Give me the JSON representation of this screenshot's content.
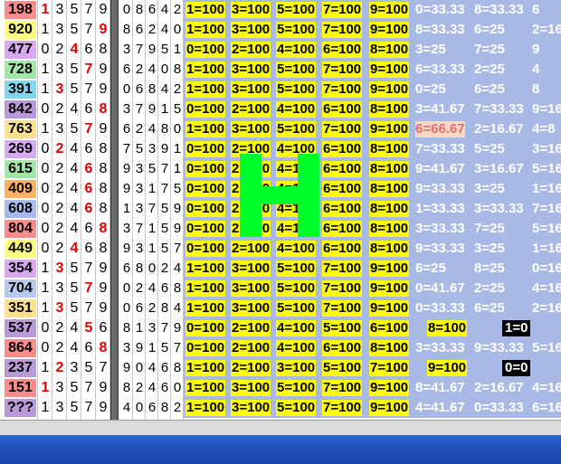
{
  "rows": [
    {
      "code": "198",
      "code_bg": "#ff8c8c",
      "digits": [
        "1",
        "3",
        "5",
        "7",
        "9"
      ],
      "hot": [
        0
      ],
      "perm": [
        "0",
        "8",
        "6",
        "4",
        "2"
      ],
      "cells": [
        [
          "1=100",
          "y"
        ],
        [
          "3=100",
          "y"
        ],
        [
          "5=100",
          "y"
        ],
        [
          "7=100",
          "y"
        ],
        [
          "9=100",
          "y"
        ],
        [
          "0=33.33",
          "w"
        ],
        [
          "8=33.33",
          "w"
        ],
        [
          "6",
          "w"
        ]
      ]
    },
    {
      "code": "920",
      "code_bg": "#ffff7f",
      "digits": [
        "1",
        "3",
        "5",
        "7",
        "9"
      ],
      "hot": [
        4
      ],
      "perm": [
        "8",
        "6",
        "2",
        "4",
        "0"
      ],
      "cells": [
        [
          "1=100",
          "y"
        ],
        [
          "3=100",
          "y"
        ],
        [
          "5=100",
          "y"
        ],
        [
          "7=100",
          "y"
        ],
        [
          "9=100",
          "y"
        ],
        [
          "8=33.33",
          "w"
        ],
        [
          "6=25",
          "w"
        ],
        [
          "2=16",
          "w"
        ]
      ]
    },
    {
      "code": "477",
      "code_bg": "#d8a8f0",
      "digits": [
        "0",
        "2",
        "4",
        "6",
        "8"
      ],
      "hot": [
        2
      ],
      "perm": [
        "3",
        "7",
        "9",
        "5",
        "1"
      ],
      "cells": [
        [
          "0=100",
          "y"
        ],
        [
          "2=100",
          "y"
        ],
        [
          "4=100",
          "y"
        ],
        [
          "6=100",
          "y"
        ],
        [
          "8=100",
          "y"
        ],
        [
          "3=25",
          "w"
        ],
        [
          "7=25",
          "w"
        ],
        [
          "9",
          "w"
        ]
      ]
    },
    {
      "code": "728",
      "code_bg": "#9fe8a8",
      "digits": [
        "1",
        "3",
        "5",
        "7",
        "9"
      ],
      "hot": [
        3
      ],
      "perm": [
        "6",
        "2",
        "4",
        "0",
        "8"
      ],
      "cells": [
        [
          "1=100",
          "y"
        ],
        [
          "3=100",
          "y"
        ],
        [
          "5=100",
          "y"
        ],
        [
          "7=100",
          "y"
        ],
        [
          "9=100",
          "y"
        ],
        [
          "6=33.33",
          "w"
        ],
        [
          "2=25",
          "w"
        ],
        [
          "4",
          "w"
        ]
      ]
    },
    {
      "code": "391",
      "code_bg": "#7fd8f0",
      "digits": [
        "1",
        "3",
        "5",
        "7",
        "9"
      ],
      "hot": [
        1
      ],
      "perm": [
        "0",
        "6",
        "8",
        "4",
        "2"
      ],
      "cells": [
        [
          "1=100",
          "y"
        ],
        [
          "3=100",
          "y"
        ],
        [
          "5=100",
          "y"
        ],
        [
          "7=100",
          "y"
        ],
        [
          "9=100",
          "y"
        ],
        [
          "0=25",
          "w"
        ],
        [
          "6=25",
          "w"
        ],
        [
          "8",
          "w"
        ]
      ]
    },
    {
      "code": "842",
      "code_bg": "#b89ad8",
      "digits": [
        "0",
        "2",
        "4",
        "6",
        "8"
      ],
      "hot": [
        4
      ],
      "perm": [
        "3",
        "7",
        "9",
        "1",
        "5"
      ],
      "cells": [
        [
          "0=100",
          "y"
        ],
        [
          "2=100",
          "y"
        ],
        [
          "4=100",
          "y"
        ],
        [
          "6=100",
          "y"
        ],
        [
          "8=100",
          "y"
        ],
        [
          "3=41.67",
          "w"
        ],
        [
          "7=33.33",
          "w"
        ],
        [
          "9=16",
          "w"
        ]
      ]
    },
    {
      "code": "763",
      "code_bg": "#ffe08a",
      "digits": [
        "1",
        "3",
        "5",
        "7",
        "9"
      ],
      "hot": [
        3
      ],
      "perm": [
        "6",
        "2",
        "4",
        "8",
        "0"
      ],
      "cells": [
        [
          "1=100",
          "y"
        ],
        [
          "3=100",
          "y"
        ],
        [
          "5=100",
          "y"
        ],
        [
          "7=100",
          "y"
        ],
        [
          "9=100",
          "y"
        ],
        [
          "6=66.67",
          "pk"
        ],
        [
          "2=16.67",
          "w"
        ],
        [
          "4=8",
          "w"
        ]
      ]
    },
    {
      "code": "269",
      "code_bg": "#d8a8f0",
      "digits": [
        "0",
        "2",
        "4",
        "6",
        "8"
      ],
      "hot": [
        1
      ],
      "perm": [
        "7",
        "5",
        "3",
        "9",
        "1"
      ],
      "cells": [
        [
          "0=100",
          "y"
        ],
        [
          "2=100",
          "y"
        ],
        [
          "4=100",
          "y"
        ],
        [
          "6=100",
          "y"
        ],
        [
          "8=100",
          "y"
        ],
        [
          "7=33.33",
          "w"
        ],
        [
          "5=25",
          "w"
        ],
        [
          "3=16",
          "w"
        ]
      ]
    },
    {
      "code": "615",
      "code_bg": "#9fe8a8",
      "digits": [
        "0",
        "2",
        "4",
        "6",
        "8"
      ],
      "hot": [
        3
      ],
      "perm": [
        "9",
        "3",
        "5",
        "7",
        "1"
      ],
      "cells": [
        [
          "0=100",
          "y"
        ],
        [
          "2=100",
          "y"
        ],
        [
          "4=100",
          "y"
        ],
        [
          "6=100",
          "y"
        ],
        [
          "8=100",
          "y"
        ],
        [
          "9=41.67",
          "w"
        ],
        [
          "3=16.67",
          "w"
        ],
        [
          "5=16",
          "w"
        ]
      ]
    },
    {
      "code": "409",
      "code_bg": "#ffb060",
      "digits": [
        "0",
        "2",
        "4",
        "6",
        "8"
      ],
      "hot": [
        3
      ],
      "perm": [
        "9",
        "3",
        "1",
        "7",
        "5"
      ],
      "cells": [
        [
          "0=100",
          "y"
        ],
        [
          "2=100",
          "y"
        ],
        [
          "4=100",
          "y"
        ],
        [
          "6=100",
          "y"
        ],
        [
          "8=100",
          "y"
        ],
        [
          "9=33.33",
          "w"
        ],
        [
          "3=25",
          "w"
        ],
        [
          "1=16",
          "w"
        ]
      ]
    },
    {
      "code": "608",
      "code_bg": "#a8b8f0",
      "digits": [
        "0",
        "2",
        "4",
        "6",
        "8"
      ],
      "hot": [
        3
      ],
      "perm": [
        "1",
        "3",
        "7",
        "5",
        "9"
      ],
      "cells": [
        [
          "0=100",
          "y"
        ],
        [
          "2=100",
          "y"
        ],
        [
          "4=100",
          "y"
        ],
        [
          "6=100",
          "y"
        ],
        [
          "8=100",
          "y"
        ],
        [
          "1=33.33",
          "w"
        ],
        [
          "3=33.33",
          "w"
        ],
        [
          "7=16",
          "w"
        ]
      ]
    },
    {
      "code": "804",
      "code_bg": "#ff8c8c",
      "digits": [
        "0",
        "2",
        "4",
        "6",
        "8"
      ],
      "hot": [
        4
      ],
      "perm": [
        "3",
        "7",
        "1",
        "5",
        "9"
      ],
      "cells": [
        [
          "0=100",
          "y"
        ],
        [
          "2=100",
          "y"
        ],
        [
          "4=100",
          "y"
        ],
        [
          "6=100",
          "y"
        ],
        [
          "8=100",
          "y"
        ],
        [
          "3=33.33",
          "w"
        ],
        [
          "7=25",
          "w"
        ],
        [
          "5=16",
          "w"
        ]
      ]
    },
    {
      "code": "449",
      "code_bg": "#ffff7f",
      "digits": [
        "0",
        "2",
        "4",
        "6",
        "8"
      ],
      "hot": [
        2
      ],
      "perm": [
        "9",
        "3",
        "1",
        "5",
        "7"
      ],
      "cells": [
        [
          "0=100",
          "y"
        ],
        [
          "2=100",
          "y"
        ],
        [
          "4=100",
          "y"
        ],
        [
          "6=100",
          "y"
        ],
        [
          "8=100",
          "y"
        ],
        [
          "9=33.33",
          "w"
        ],
        [
          "3=25",
          "w"
        ],
        [
          "1=16",
          "w"
        ]
      ]
    },
    {
      "code": "354",
      "code_bg": "#d8a8f0",
      "digits": [
        "1",
        "3",
        "5",
        "7",
        "9"
      ],
      "hot": [
        1
      ],
      "perm": [
        "6",
        "8",
        "0",
        "2",
        "4"
      ],
      "cells": [
        [
          "1=100",
          "y"
        ],
        [
          "3=100",
          "y"
        ],
        [
          "5=100",
          "y"
        ],
        [
          "7=100",
          "y"
        ],
        [
          "9=100",
          "y"
        ],
        [
          "6=25",
          "w"
        ],
        [
          "8=25",
          "w"
        ],
        [
          "0=16",
          "w"
        ]
      ]
    },
    {
      "code": "704",
      "code_bg": "#b8c8f0",
      "digits": [
        "1",
        "3",
        "5",
        "7",
        "9"
      ],
      "hot": [
        3
      ],
      "perm": [
        "0",
        "2",
        "4",
        "6",
        "8"
      ],
      "cells": [
        [
          "1=100",
          "y"
        ],
        [
          "3=100",
          "y"
        ],
        [
          "5=100",
          "y"
        ],
        [
          "7=100",
          "y"
        ],
        [
          "9=100",
          "y"
        ],
        [
          "0=41.67",
          "w"
        ],
        [
          "2=25",
          "w"
        ],
        [
          "4=16",
          "w"
        ]
      ]
    },
    {
      "code": "351",
      "code_bg": "#ffe08a",
      "digits": [
        "1",
        "3",
        "5",
        "7",
        "9"
      ],
      "hot": [
        1
      ],
      "perm": [
        "0",
        "6",
        "2",
        "8",
        "4"
      ],
      "cells": [
        [
          "1=100",
          "y"
        ],
        [
          "3=100",
          "y"
        ],
        [
          "5=100",
          "y"
        ],
        [
          "7=100",
          "y"
        ],
        [
          "9=100",
          "y"
        ],
        [
          "0=33.33",
          "w"
        ],
        [
          "6=25",
          "w"
        ],
        [
          "2=16",
          "w"
        ]
      ]
    },
    {
      "code": "537",
      "code_bg": "#b89ad8",
      "digits": [
        "0",
        "2",
        "4",
        "5",
        "6"
      ],
      "hot": [
        3
      ],
      "perm": [
        "8",
        "1",
        "3",
        "7",
        "9"
      ],
      "cells": [
        [
          "0=100",
          "y"
        ],
        [
          "2=100",
          "y"
        ],
        [
          "4=100",
          "y"
        ],
        [
          "5=100",
          "y"
        ],
        [
          "6=100",
          "y"
        ],
        [
          "8=100",
          "y"
        ],
        [
          "1=0",
          "k"
        ]
      ]
    },
    {
      "code": "864",
      "code_bg": "#ff8c8c",
      "digits": [
        "0",
        "2",
        "4",
        "6",
        "8"
      ],
      "hot": [
        4
      ],
      "perm": [
        "3",
        "9",
        "1",
        "5",
        "7"
      ],
      "cells": [
        [
          "0=100",
          "y"
        ],
        [
          "2=100",
          "y"
        ],
        [
          "4=100",
          "y"
        ],
        [
          "6=100",
          "y"
        ],
        [
          "8=100",
          "y"
        ],
        [
          "3=33.33",
          "w"
        ],
        [
          "9=33.33",
          "w"
        ],
        [
          "5=16",
          "w"
        ]
      ]
    },
    {
      "code": "237",
      "code_bg": "#b89ad8",
      "digits": [
        "1",
        "2",
        "3",
        "5",
        "7"
      ],
      "hot": [
        1
      ],
      "perm": [
        "9",
        "0",
        "4",
        "6",
        "8"
      ],
      "cells": [
        [
          "1=100",
          "y"
        ],
        [
          "2=100",
          "y"
        ],
        [
          "3=100",
          "y"
        ],
        [
          "5=100",
          "y"
        ],
        [
          "7=100",
          "y"
        ],
        [
          "9=100",
          "y"
        ],
        [
          "0=0",
          "k"
        ]
      ]
    },
    {
      "code": "151",
      "code_bg": "#ff8c8c",
      "digits": [
        "1",
        "3",
        "5",
        "7",
        "9"
      ],
      "hot": [
        0
      ],
      "perm": [
        "8",
        "2",
        "4",
        "6",
        "0"
      ],
      "cells": [
        [
          "1=100",
          "y"
        ],
        [
          "3=100",
          "y"
        ],
        [
          "5=100",
          "y"
        ],
        [
          "7=100",
          "y"
        ],
        [
          "9=100",
          "y"
        ],
        [
          "8=41.67",
          "w"
        ],
        [
          "2=16.67",
          "w"
        ],
        [
          "4=16",
          "w"
        ]
      ]
    },
    {
      "code": "???",
      "code_bg": "#b89ad8",
      "digits": [
        "1",
        "3",
        "5",
        "7",
        "9"
      ],
      "hot": [],
      "perm": [
        "4",
        "0",
        "6",
        "8",
        "2"
      ],
      "cells": [
        [
          "1=100",
          "y"
        ],
        [
          "3=100",
          "y"
        ],
        [
          "5=100",
          "y"
        ],
        [
          "7=100",
          "y"
        ],
        [
          "9=100",
          "y"
        ],
        [
          "4=41.67",
          "w"
        ],
        [
          "0=33.33",
          "w"
        ],
        [
          "6=16",
          "w"
        ]
      ]
    }
  ],
  "overlay_letter": "H",
  "colors": {
    "panel": "#a7b9e4",
    "yellow": "#ffff00",
    "hot": "#e00000",
    "overlay": "#00ff2a",
    "taskbar": "#245edb"
  }
}
